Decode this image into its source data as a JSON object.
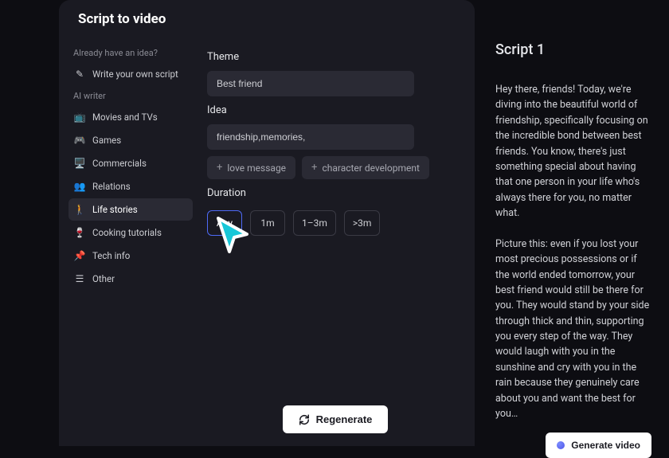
{
  "header": {
    "title": "Script to video"
  },
  "sidebar": {
    "idea_label": "Already have an idea?",
    "write_own": "Write your own script",
    "ai_label": "AI writer",
    "items": [
      {
        "label": "Movies and TVs",
        "icon": "📺"
      },
      {
        "label": "Games",
        "icon": "🎮"
      },
      {
        "label": "Commercials",
        "icon": "🖥️"
      },
      {
        "label": "Relations",
        "icon": "👥"
      },
      {
        "label": "Life stories",
        "icon": "🚶"
      },
      {
        "label": "Cooking tutorials",
        "icon": "🍷"
      },
      {
        "label": "Tech info",
        "icon": "📌"
      },
      {
        "label": "Other",
        "icon": "☰"
      }
    ],
    "selected_index": 4
  },
  "form": {
    "theme_label": "Theme",
    "theme_value": "Best friend",
    "idea_label": "Idea",
    "idea_value": "friendship,memories,",
    "suggestions": [
      "love message",
      "character development"
    ],
    "duration_label": "Duration",
    "durations": [
      "Any",
      "1m",
      "1–3m",
      ">3m"
    ],
    "duration_selected": 0,
    "regenerate_label": "Regenerate"
  },
  "script_panel": {
    "title": "Script 1",
    "body": "Hey there, friends! Today, we're diving into the beautiful world of friendship, specifically focusing on the incredible bond between best friends. You know, there's just something special about having that one person in your life who's always there for you, no matter what.\n\nPicture this: even if you lost your most precious possessions or if the world ended tomorrow, your best friend would still be there for you. They would stand by your side through thick and thin, supporting you every step of the way. They would laugh with you in the sunshine and cry with you in the rain because they genuinely care about you and want the best for you…",
    "generate_label": "Generate video"
  }
}
